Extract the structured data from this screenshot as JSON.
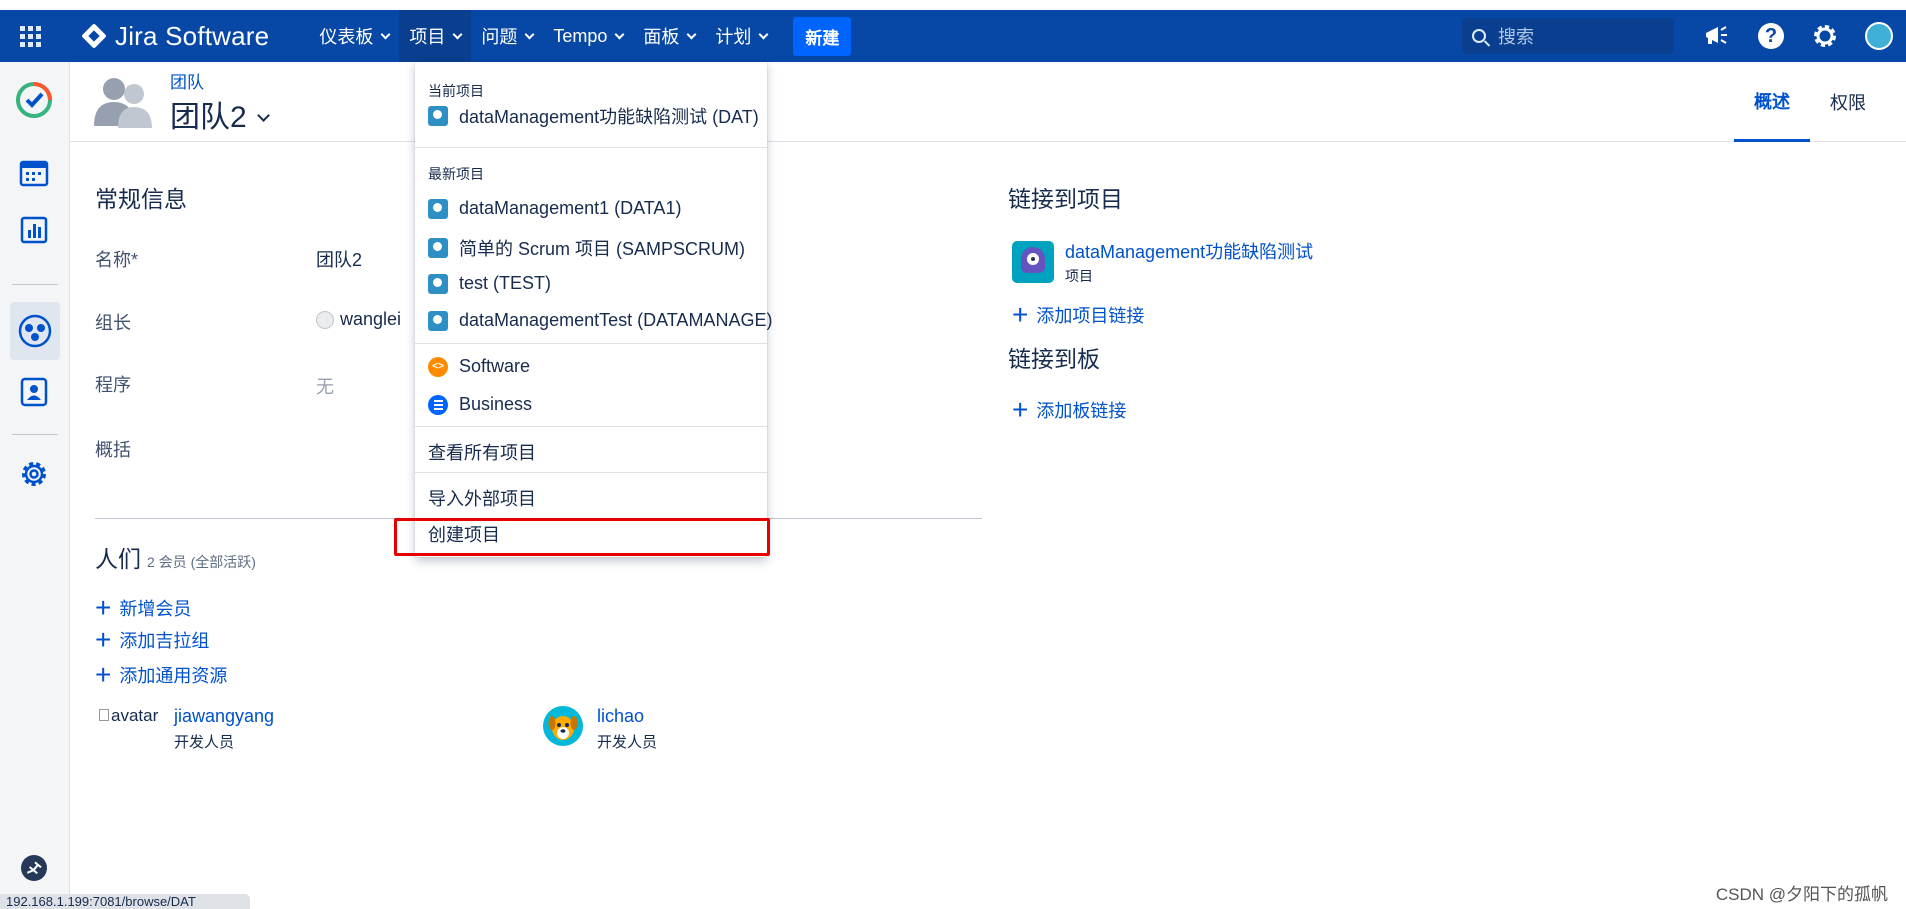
{
  "nav": {
    "logo_text": "Jira Software",
    "items": [
      {
        "label": "仪表板"
      },
      {
        "label": "项目"
      },
      {
        "label": "问题"
      },
      {
        "label": "Tempo"
      },
      {
        "label": "面板"
      },
      {
        "label": "计划"
      }
    ],
    "create_label": "新建",
    "search_placeholder": "搜索"
  },
  "header": {
    "breadcrumb": "团队",
    "title": "团队2",
    "tabs": [
      {
        "label": "概述",
        "active": true
      },
      {
        "label": "权限",
        "active": false
      }
    ]
  },
  "general": {
    "section_title": "常规信息",
    "fields": [
      {
        "label": "名称*",
        "value": "团队2"
      },
      {
        "label": "组长",
        "value": "wanglei"
      },
      {
        "label": "程序",
        "value": "无"
      },
      {
        "label": "概括",
        "value": ""
      }
    ]
  },
  "people": {
    "title": "人们",
    "count_text": "2 会员 (全部活跃)",
    "actions": [
      "新增会员",
      "添加吉拉组",
      "添加通用资源"
    ],
    "members": [
      {
        "avatar_alt": "avatar",
        "name": "jiawangyang",
        "role": "开发人员"
      },
      {
        "name": "lichao",
        "role": "开发人员"
      }
    ]
  },
  "links": {
    "projects_title": "链接到项目",
    "project_name": "dataManagement功能缺陷测试",
    "project_type": "项目",
    "add_project_link": "添加项目链接",
    "boards_title": "链接到板",
    "add_board_link": "添加板链接"
  },
  "dropdown": {
    "current_header": "当前项目",
    "current_item": "dataManagement功能缺陷测试 (DAT)",
    "recent_header": "最新项目",
    "recent_items": [
      "dataManagement1 (DATA1)",
      "简单的 Scrum 项目 (SAMPSCRUM)",
      "test (TEST)",
      "dataManagementTest (DATAMANAGE)"
    ],
    "types": [
      "Software",
      "Business"
    ],
    "view_all": "查看所有项目",
    "import": "导入外部项目",
    "create": "创建项目"
  },
  "status_url": "192.168.1.199:7081/browse/DAT",
  "watermark": "CSDN @夕阳下的孤帆",
  "colors": {
    "navbar": "#0747a6",
    "link": "#0052cc",
    "highlight_box": "#e60000"
  }
}
